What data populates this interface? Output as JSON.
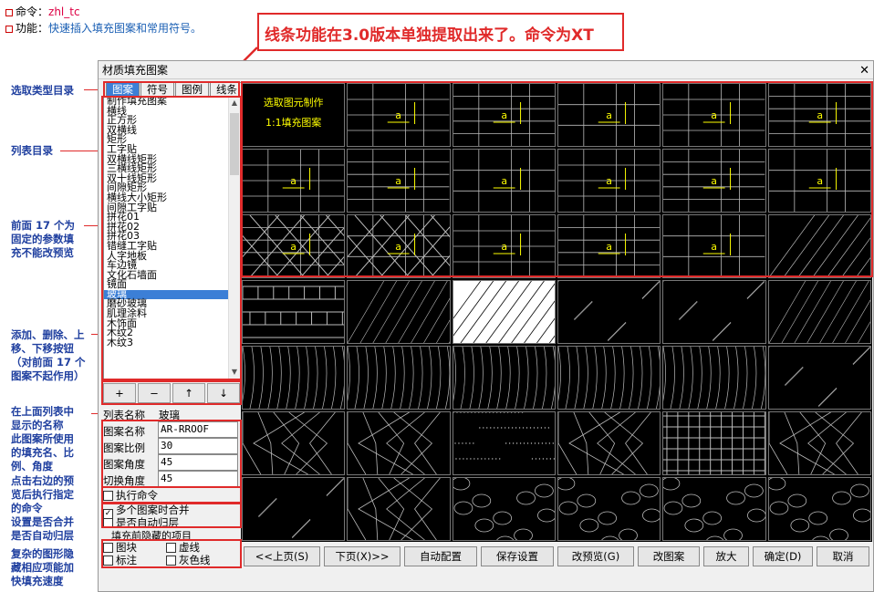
{
  "info": {
    "cmd_label": "命令：",
    "cmd_value": "zhl_tc",
    "func_label": "功能：",
    "func_value": "快速插入填充图案和常用符号。"
  },
  "callout": "线条功能在3.0版本单独提取出来了。命令为XT",
  "annotations": [
    "选取类型目录",
    "列表目录",
    "前面 17 个为\n固定的参数填\n充不能改预览",
    "添加、删除、上\n移、下移按钮\n（对前面 17 个\n图案不起作用）",
    "在上面列表中\n显示的名称",
    "此图案所使用\n的填充名、比\n例、角度",
    "点击右边的预\n览后执行指定\n的命令",
    "设置是否合并\n是否自动归层",
    "复杂的图形隐\n藏相应项能加\n快填充速度"
  ],
  "dialog": {
    "title": "材质填充图案",
    "tabs": [
      "图案",
      "符号",
      "图例",
      "线条"
    ],
    "list_items": [
      "制作填充图案",
      "横线",
      "正方形",
      "双横线",
      "矩形",
      "工字贴",
      "双横线矩形",
      "三横线矩形",
      "双十线矩形",
      "间隙矩形",
      "横线大小矩形",
      "间隙工字贴",
      "拼花01",
      "拼花02",
      "拼花03",
      "错缝工字贴",
      "人字地板",
      "车边镜",
      "文化石墙面",
      "镜面",
      "玻璃",
      "磨砂玻璃",
      "肌理涂料",
      "木饰面",
      "木纹2",
      "木纹3"
    ],
    "selected_index": 20,
    "list_buttons": [
      "+",
      "−",
      "↑",
      "↓"
    ],
    "list_name_label": "列表名称",
    "list_name_value": "玻璃",
    "fields": [
      {
        "label": "图案名称",
        "value": "AR-RROOF"
      },
      {
        "label": "图案比例",
        "value": "30"
      },
      {
        "label": "图案角度",
        "value": "45"
      },
      {
        "label": "切换角度",
        "value": "45"
      }
    ],
    "exec_cmd_label": "执行命令",
    "merge_label": "多个图案时合并",
    "merge_checked": true,
    "autolayer_label": "是否自动归层",
    "hidden_group_label": "填充前隐藏的项目",
    "hide_items": [
      "图块",
      "虚线",
      "标注",
      "灰色线"
    ],
    "preview_note": [
      "选取图元制作",
      "1:1填充图案"
    ],
    "bottom_buttons": [
      "<<上页(S)",
      "下页(X)>>",
      "自动配置",
      "保存设置",
      "改预览(G)",
      "改图案",
      "放大",
      "确定(D)",
      "取消"
    ],
    "colors": {
      "accent": "#3c7fd6",
      "annotation": "#e02a2a",
      "anno_text": "#1f3f9f",
      "cad_yellow": "#ffff00"
    }
  }
}
